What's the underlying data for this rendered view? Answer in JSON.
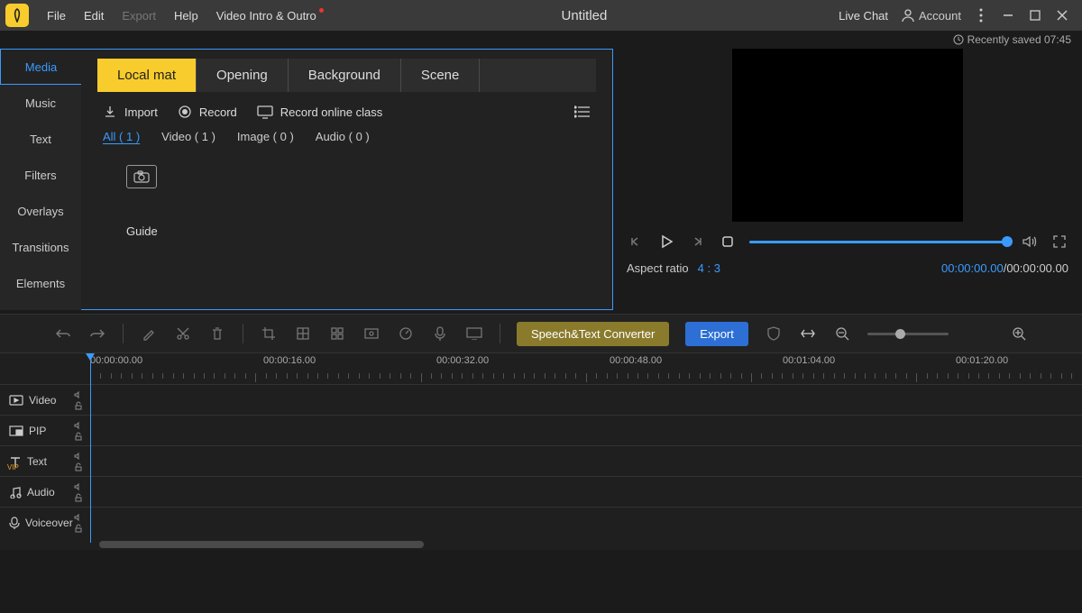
{
  "menus": {
    "file": "File",
    "edit": "Edit",
    "export": "Export",
    "help": "Help",
    "vio": "Video Intro & Outro"
  },
  "doc_title": "Untitled",
  "header_right": {
    "live_chat": "Live Chat",
    "account": "Account"
  },
  "saved": "Recently saved 07:45",
  "side_tabs": [
    "Media",
    "Music",
    "Text",
    "Filters",
    "Overlays",
    "Transitions",
    "Elements"
  ],
  "cat_tabs": [
    "Local mat",
    "Opening",
    "Background",
    "Scene"
  ],
  "import_row": {
    "import": "Import",
    "record": "Record",
    "record_online": "Record online class"
  },
  "filters": {
    "all": "All ( 1 )",
    "video": "Video ( 1 )",
    "image": "Image ( 0 )",
    "audio": "Audio ( 0 )"
  },
  "guide_label": "Guide",
  "aspect": {
    "label": "Aspect ratio",
    "value": "4 : 3"
  },
  "time": {
    "current": "00:00:00.00",
    "sep": "  /  ",
    "total": "00:00:00.00"
  },
  "toolbar": {
    "st": "Speech&Text Converter",
    "export": "Export"
  },
  "ruler": [
    "00:00:00.00",
    "00:00:16.00",
    "00:00:32.00",
    "00:00:48.00",
    "00:01:04.00",
    "00:01:20.00"
  ],
  "tracks": [
    "Video",
    "PIP",
    "Text",
    "Audio",
    "Voiceover"
  ]
}
